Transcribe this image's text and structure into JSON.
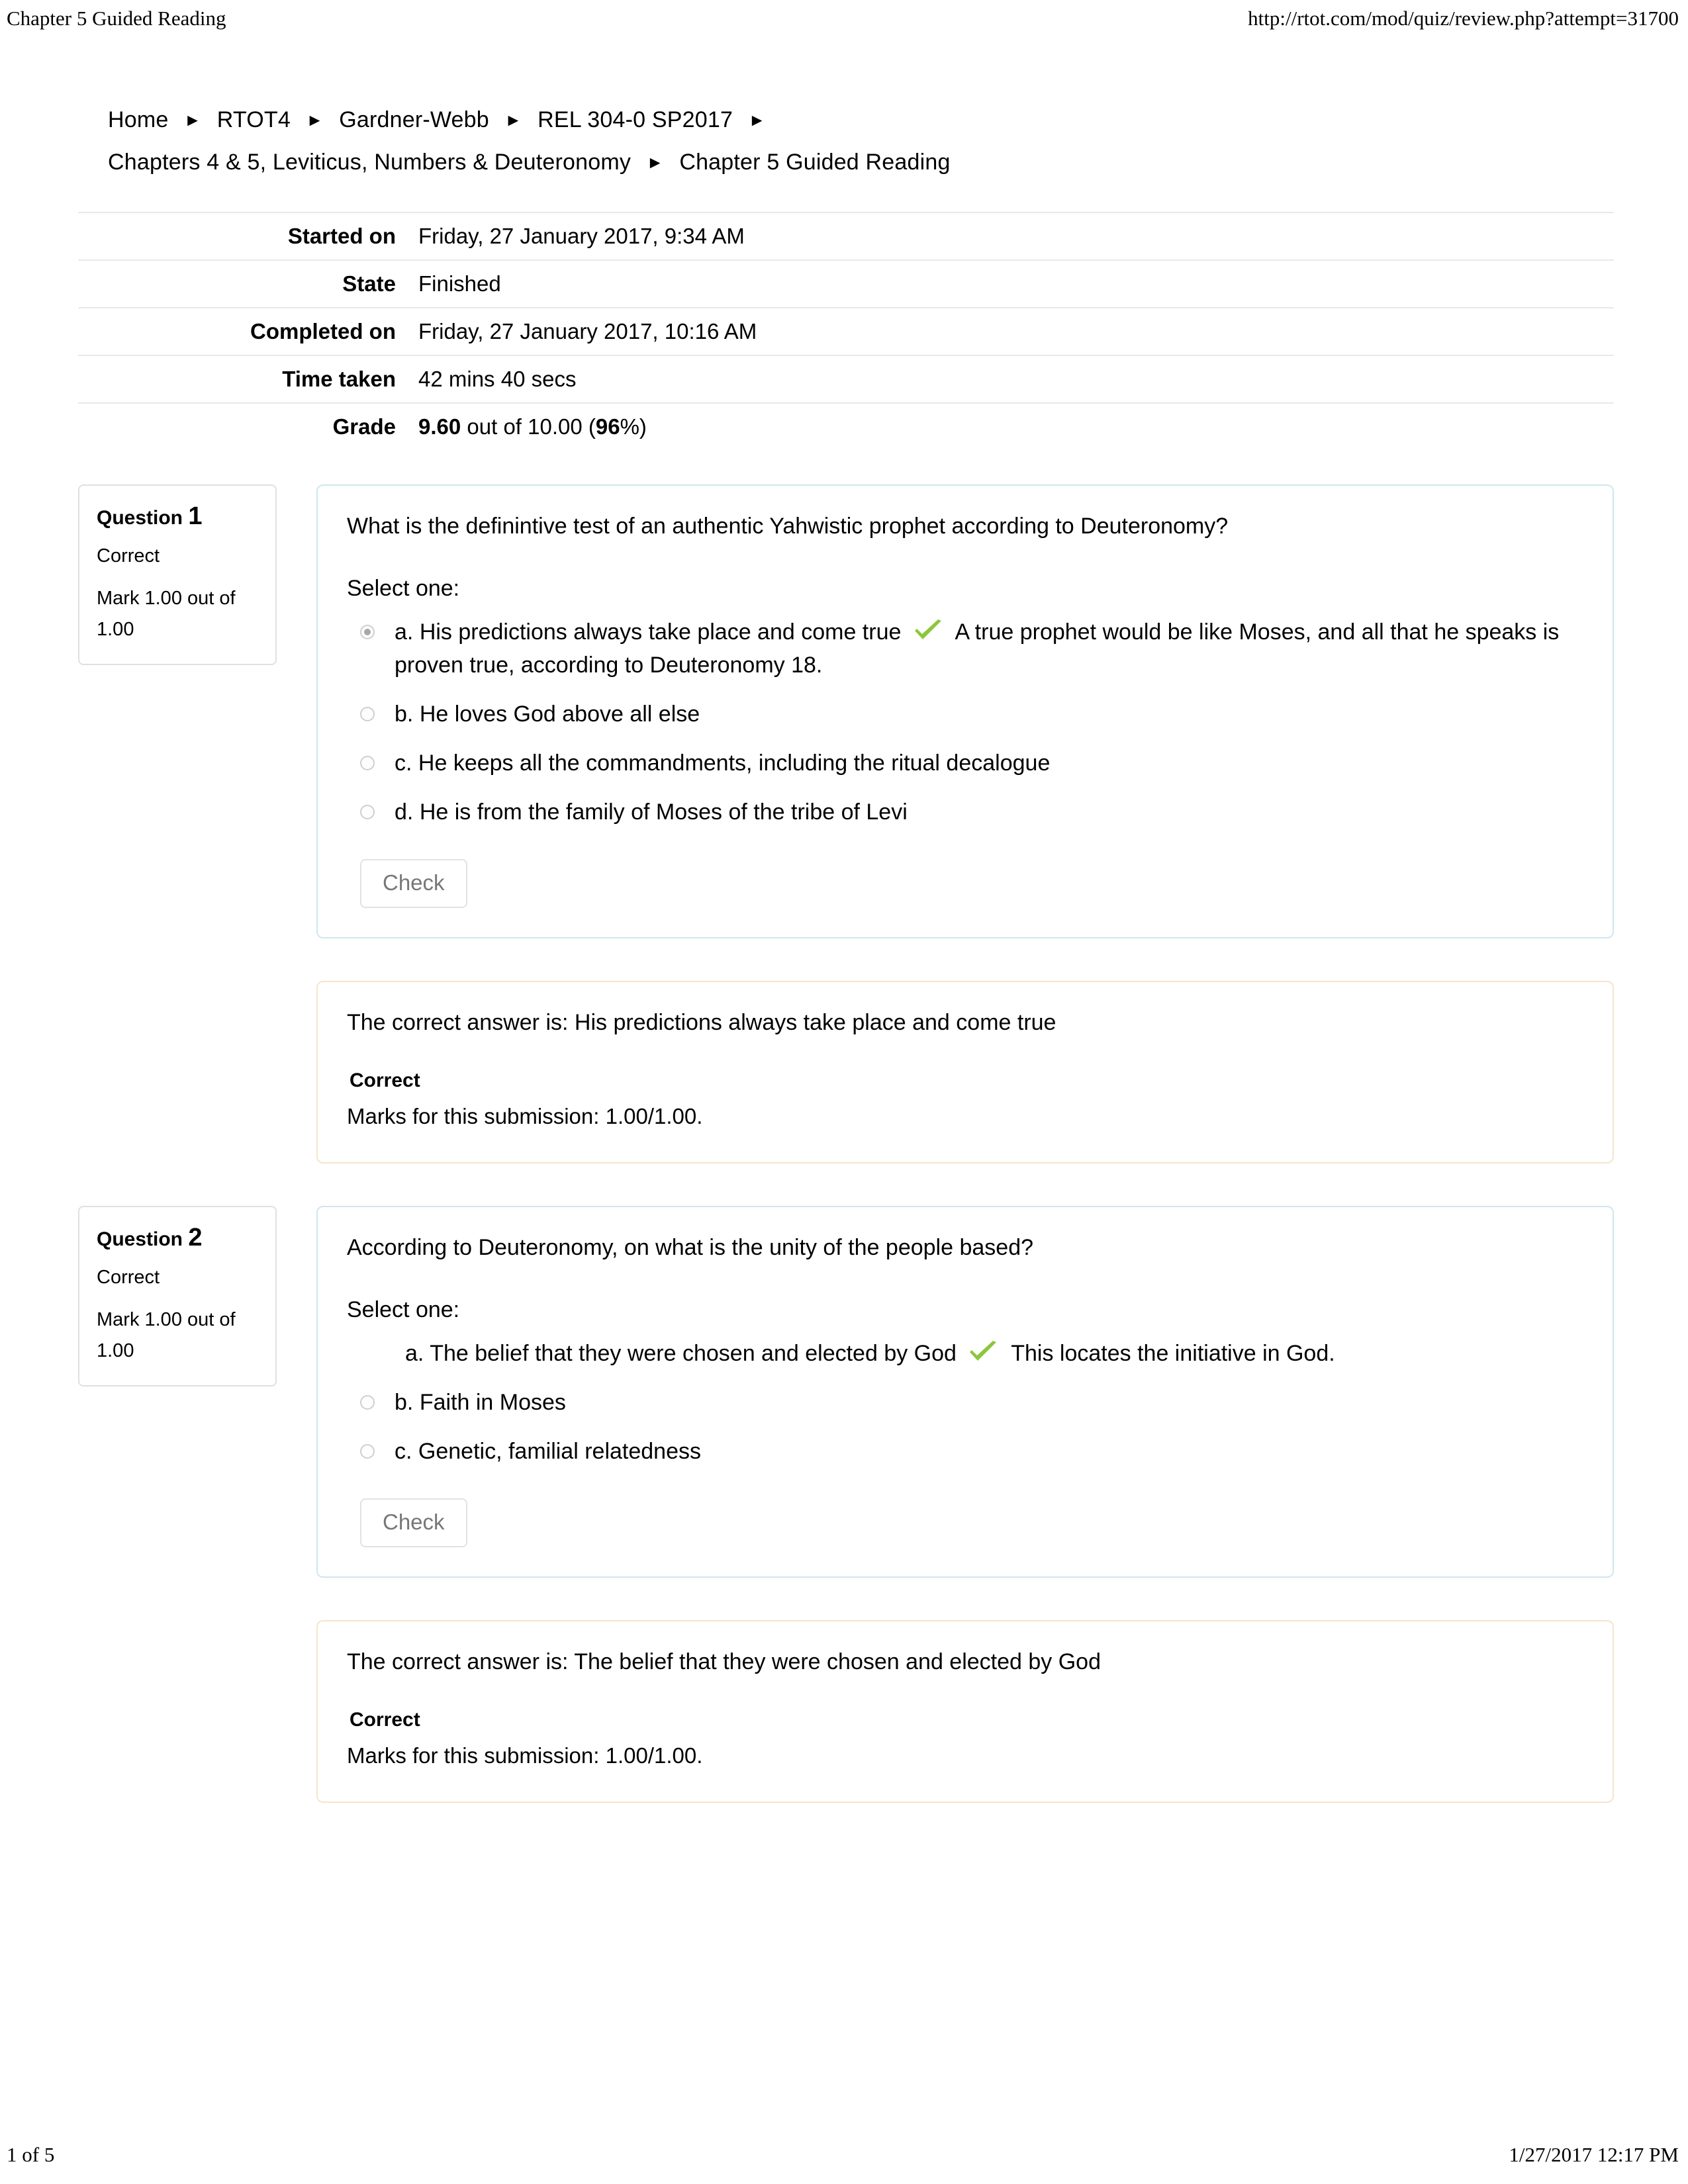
{
  "print_header": {
    "left": "Chapter 5 Guided Reading",
    "right": "http://rtot.com/mod/quiz/review.php?attempt=31700"
  },
  "print_footer": {
    "left": "1 of 5",
    "right": "1/27/2017 12:17 PM"
  },
  "breadcrumb": {
    "separator": "►",
    "items": [
      "Home",
      "RTOT4",
      "Gardner-Webb",
      "REL 304-0 SP2017",
      "Chapters 4 & 5, Leviticus, Numbers & Deuteronomy",
      "Chapter 5 Guided Reading"
    ]
  },
  "summary": {
    "rows": [
      {
        "label": "Started on",
        "value": "Friday, 27 January 2017, 9:34 AM"
      },
      {
        "label": "State",
        "value": "Finished"
      },
      {
        "label": "Completed on",
        "value": "Friday, 27 January 2017, 10:16 AM"
      },
      {
        "label": "Time taken",
        "value": "42 mins 40 secs"
      }
    ],
    "grade": {
      "label": "Grade",
      "score": "9.60",
      "middle": " out of 10.00 (",
      "percent": "96",
      "suffix": "%)"
    }
  },
  "colors": {
    "question_box_border": "#cfe7ef",
    "info_box_border": "#e0e0e0",
    "feedback_box_border": "#f6e4cd",
    "tick_green": "#8cc63e",
    "button_text": "#777777",
    "radio_border": "#cfcfcf"
  },
  "questions": [
    {
      "info": {
        "title_prefix": "Question",
        "number": "1",
        "state": "Correct",
        "mark": "Mark 1.00 out of 1.00"
      },
      "text": "What is the definintive test of an authentic Yahwistic prophet according to Deuteronomy?",
      "select_one": "Select one:",
      "answers": [
        {
          "letter": "a.",
          "text": "His predictions always take place and come true",
          "selected": true,
          "radio_visible": true,
          "tick": true,
          "feedback": "A true prophet would be like Moses, and all that he speaks is proven true, according to Deuteronomy 18."
        },
        {
          "letter": "b.",
          "text": "He loves God above all else",
          "selected": false,
          "radio_visible": true,
          "tick": false,
          "feedback": ""
        },
        {
          "letter": "c.",
          "text": "He keeps all the commandments, including the ritual decalogue",
          "selected": false,
          "radio_visible": true,
          "tick": false,
          "feedback": ""
        },
        {
          "letter": "d.",
          "text": "He is from the family of Moses of the tribe of Levi",
          "selected": false,
          "radio_visible": true,
          "tick": false,
          "feedback": ""
        }
      ],
      "check_label": "Check",
      "feedback_box": {
        "correct_answer": "The correct answer is: His predictions always take place and come true",
        "grade_text": "Correct",
        "marks_text": "Marks for this submission: 1.00/1.00."
      }
    },
    {
      "info": {
        "title_prefix": "Question",
        "number": "2",
        "state": "Correct",
        "mark": "Mark 1.00 out of 1.00"
      },
      "text": "According to Deuteronomy, on what is the unity of the people based?",
      "select_one": "Select one:",
      "answers": [
        {
          "letter": "a.",
          "text": "The belief that they were chosen and elected by God",
          "selected": true,
          "radio_visible": false,
          "tick": true,
          "feedback": "This locates the initiative in God."
        },
        {
          "letter": "b.",
          "text": "Faith in Moses",
          "selected": false,
          "radio_visible": true,
          "tick": false,
          "feedback": ""
        },
        {
          "letter": "c.",
          "text": "Genetic, familial relatedness",
          "selected": false,
          "radio_visible": true,
          "tick": false,
          "feedback": ""
        }
      ],
      "check_label": "Check",
      "feedback_box": {
        "correct_answer": "The correct answer is: The belief that they were chosen and elected by God",
        "grade_text": "Correct",
        "marks_text": "Marks for this submission: 1.00/1.00."
      }
    }
  ]
}
